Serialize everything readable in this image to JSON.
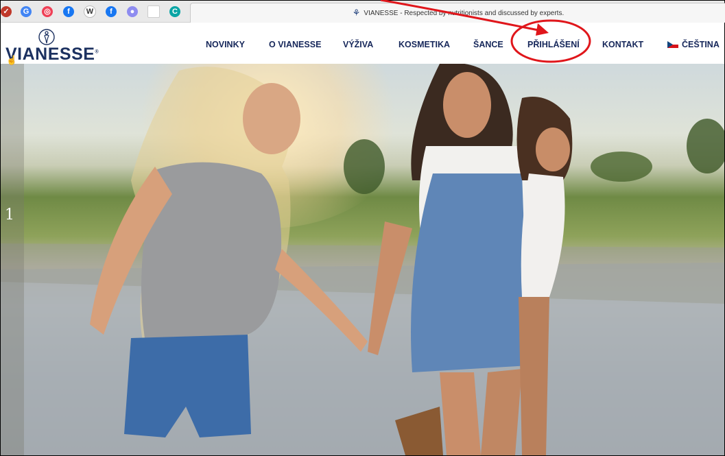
{
  "browser": {
    "pinned_tabs": [
      {
        "icon": "mail-check-icon",
        "glyph": "✓",
        "color": "#c0392b"
      },
      {
        "icon": "translate-icon",
        "glyph": "G",
        "color": "#4285f4"
      },
      {
        "icon": "pocket-icon",
        "glyph": "◎",
        "color": "#ef4056"
      },
      {
        "icon": "facebook-icon",
        "glyph": "f",
        "color": "#1877f2"
      },
      {
        "icon": "wikipedia-icon",
        "glyph": "W",
        "color": "#333333"
      },
      {
        "icon": "facebook-icon",
        "glyph": "f",
        "color": "#1877f2"
      },
      {
        "icon": "chat-bubble-icon",
        "glyph": "●",
        "color": "#8e8cf0"
      },
      {
        "icon": "blank-page-icon",
        "glyph": "",
        "color": "#ffffff"
      },
      {
        "icon": "c-logo-icon",
        "glyph": "C",
        "color": "#0aa5a5"
      }
    ],
    "active_tab_title": "VIANESSE - Respected by nutritionists and discussed by experts."
  },
  "site": {
    "logo_text": "VIANESSE",
    "logo_mark": "®",
    "nav": [
      "NOVINKY",
      "O VIANESSE",
      "VÝŽIVA",
      "KOSMETIKA",
      "ŠANCE",
      "PŘIHLÁŠENÍ",
      "KONTAKT"
    ],
    "language": "ČEŠTINA",
    "brand_color": "#16275a"
  },
  "hero": {
    "slide_number": "1"
  },
  "annotation": {
    "color": "#e0161b",
    "highlight_target": "PŘIHLÁŠENÍ"
  }
}
